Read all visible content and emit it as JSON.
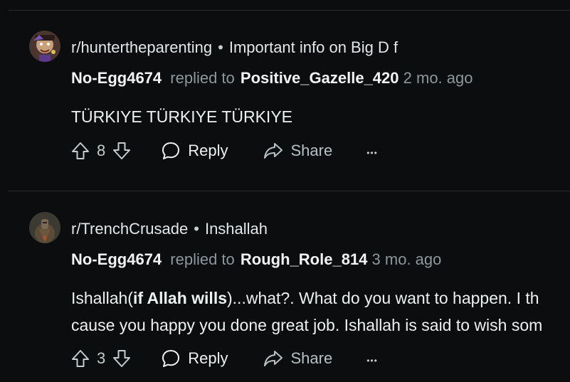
{
  "comments": [
    {
      "subreddit": "r/huntertheparenting",
      "separator": "•",
      "post_title": "Important info on Big D f",
      "author": "No-Egg4674",
      "replied_to_label": "replied to",
      "replied_to": "Positive_Gazelle_420",
      "age": "2 mo. ago",
      "body_lines": [
        "TÜRKIYE TÜRKIYE TÜRKIYE"
      ],
      "votes": "8",
      "reply_label": "Reply",
      "share_label": "Share",
      "more_label": "•••"
    },
    {
      "subreddit": "r/TrenchCrusade",
      "separator": "•",
      "post_title": "Inshallah",
      "author": "No-Egg4674",
      "replied_to_label": "replied to",
      "replied_to": "Rough_Role_814",
      "age": "3 mo. ago",
      "body_line1_prefix": "Ishallah(",
      "body_line1_bold": "if Allah wills",
      "body_line1_suffix": ")...what?. What do you want to happen. I th",
      "body_line2": "cause you happy you done great job. Ishallah is said to wish som",
      "votes": "3",
      "reply_label": "Reply",
      "share_label": "Share",
      "more_label": "•••"
    }
  ],
  "colors": {
    "background": "#0b0d0e",
    "divider": "#262a2d",
    "muted_text": "#8e979c"
  },
  "icons": [
    "avatar-huntertheparenting",
    "avatar-trenchcrusade",
    "upvote-icon",
    "downvote-icon",
    "comment-bubble-icon",
    "share-arrow-icon",
    "more-options-icon"
  ]
}
